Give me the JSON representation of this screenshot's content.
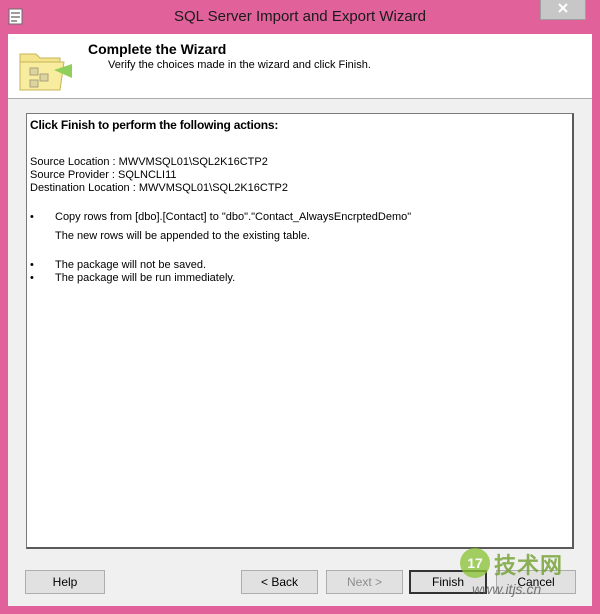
{
  "window": {
    "title": "SQL Server Import and Export Wizard",
    "icons": {
      "app": "wizard-app-icon",
      "close": "close-icon"
    }
  },
  "header": {
    "title": "Complete the Wizard",
    "subtitle": "Verify the choices made in the wizard and click Finish.",
    "icon": "wizard-package-icon"
  },
  "report": {
    "heading": "Click Finish to perform the following actions:",
    "source_location": "Source Location : MWVMSQL01\\SQL2K16CTP2",
    "source_provider": "Source Provider : SQLNCLI11",
    "destination_location": "Destination Location : MWVMSQL01\\SQL2K16CTP2",
    "bullet_symbol": "•",
    "actions": [
      {
        "text": "Copy rows from [dbo].[Contact] to \"dbo\".\"Contact_AlwaysEncrptedDemo\"",
        "detail": "The new rows will be appended to the existing table."
      },
      {
        "text": "The package will not be saved."
      },
      {
        "text": "The package will be run immediately."
      }
    ]
  },
  "buttons": {
    "help": "Help",
    "back": "< Back",
    "next": "Next >",
    "finish": "Finish",
    "cancel": "Cancel"
  },
  "watermark": {
    "badge": "17",
    "title": "技术网",
    "url": "www.itjs.cn"
  },
  "colors": {
    "frame": "#e1619b",
    "client": "#f0f0f0",
    "header_bg": "#ffffff"
  }
}
